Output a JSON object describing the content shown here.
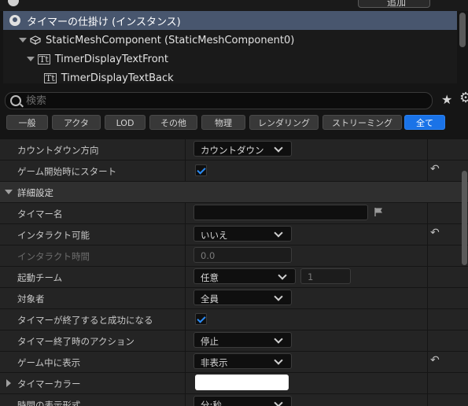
{
  "header": {
    "add_button_label": "追加"
  },
  "tree": {
    "rows": [
      {
        "label": "タイマーの仕掛け (インスタンス)"
      },
      {
        "label": "StaticMeshComponent (StaticMeshComponent0)"
      },
      {
        "label": "TimerDisplayTextFront"
      },
      {
        "label": "TimerDisplayTextBack"
      }
    ]
  },
  "search": {
    "placeholder": "検索"
  },
  "filters": [
    {
      "label": "一般"
    },
    {
      "label": "アクタ"
    },
    {
      "label": "LOD"
    },
    {
      "label": "その他"
    },
    {
      "label": "物理"
    },
    {
      "label": "レンダリング"
    },
    {
      "label": "ストリーミング"
    },
    {
      "label": "全て"
    }
  ],
  "properties": {
    "countdown_direction": {
      "label": "カウントダウン方向",
      "value": "カウントダウン"
    },
    "start_at_game_start": {
      "label": "ゲーム開始時にスタート",
      "checked": true
    },
    "advanced_section": {
      "label": "詳細設定"
    },
    "timer_name": {
      "label": "タイマー名",
      "value": ""
    },
    "can_interact": {
      "label": "インタラクト可能",
      "value": "いいえ"
    },
    "interact_time": {
      "label": "インタラクト時間",
      "value": "0.0"
    },
    "activating_team": {
      "label": "起動チーム",
      "value": "任意",
      "team_number": "1"
    },
    "target": {
      "label": "対象者",
      "value": "全員"
    },
    "succeed_on_finish": {
      "label": "タイマーが終了すると成功になる",
      "checked": true
    },
    "finish_action": {
      "label": "タイマー終了時のアクション",
      "value": "停止"
    },
    "show_in_game": {
      "label": "ゲーム中に表示",
      "value": "非表示"
    },
    "timer_color": {
      "label": "タイマーカラー",
      "color": "#ffffff"
    },
    "time_format": {
      "label": "時間の表示形式",
      "value": "分:秒"
    }
  },
  "colors": {
    "accent": "#1a73e8",
    "selection": "#48566e",
    "checkmark": "#2b8cf5"
  }
}
